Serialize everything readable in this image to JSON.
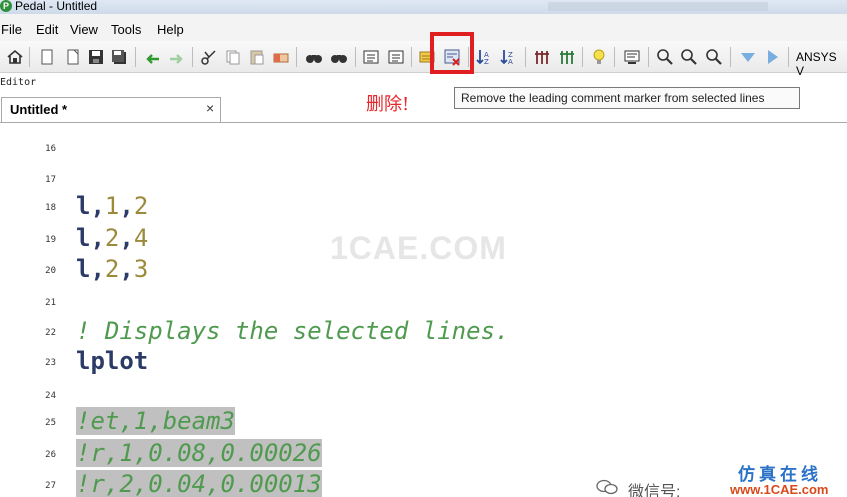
{
  "window": {
    "title": "Pedal - Untitled",
    "app_icon_letter": "P"
  },
  "menu": [
    "File",
    "Edit",
    "View",
    "Tools",
    "Help"
  ],
  "toolbar": {
    "icons": [
      "home-icon",
      "new-file-icon",
      "new-file-icon-2",
      "save-icon",
      "save-all-icon",
      "undo-icon",
      "redo-icon",
      "cut-icon",
      "copy-icon",
      "paste-icon",
      "clear-icon",
      "find-icon",
      "find-next-icon",
      "indent-icon",
      "outdent-icon",
      "comment-icon",
      "uncomment-icon",
      "sort-ascending-icon",
      "sort-descending-icon",
      "column-icon",
      "column-icon-2",
      "hint-bulb-icon",
      "settings-panel-icon",
      "zoom-in-icon",
      "zoom-out-icon",
      "zoom-reset-icon",
      "arrow-down-icon",
      "arrow-right-icon"
    ],
    "ansys_label": "ANSYS V",
    "highlight_color": "#e02020"
  },
  "editor_label": "Editor",
  "annotation_delete": "删除!",
  "tooltip": "Remove the leading comment marker from selected lines",
  "tab": {
    "label": "Untitled *",
    "close": "×"
  },
  "code_lines": [
    {
      "n": "16",
      "tokens": []
    },
    {
      "n": "17",
      "tokens": []
    },
    {
      "n": "18",
      "tokens": [
        {
          "t": "l",
          "c": "kw"
        },
        {
          "t": ",",
          "c": "kw"
        },
        {
          "t": "1",
          "c": "num"
        },
        {
          "t": ",",
          "c": "kw"
        },
        {
          "t": "2",
          "c": "num"
        }
      ]
    },
    {
      "n": "19",
      "tokens": [
        {
          "t": "l",
          "c": "kw"
        },
        {
          "t": ",",
          "c": "kw"
        },
        {
          "t": "2",
          "c": "num"
        },
        {
          "t": ",",
          "c": "kw"
        },
        {
          "t": "4",
          "c": "num"
        }
      ]
    },
    {
      "n": "20",
      "tokens": [
        {
          "t": "l",
          "c": "kw"
        },
        {
          "t": ",",
          "c": "kw"
        },
        {
          "t": "2",
          "c": "num"
        },
        {
          "t": ",",
          "c": "kw"
        },
        {
          "t": "3",
          "c": "num"
        }
      ]
    },
    {
      "n": "21",
      "tokens": []
    },
    {
      "n": "22",
      "tokens": [
        {
          "t": "! Displays the selected lines.",
          "c": "cmt"
        }
      ]
    },
    {
      "n": "23",
      "tokens": [
        {
          "t": "lplot",
          "c": "kw"
        }
      ]
    },
    {
      "n": "24",
      "tokens": []
    },
    {
      "n": "25",
      "tokens": [
        {
          "t": "!et,1,beam3",
          "c": "cmt sel"
        }
      ]
    },
    {
      "n": "26",
      "tokens": [
        {
          "t": "!r,1,0.08,0.00026",
          "c": "cmt sel"
        }
      ]
    },
    {
      "n": "27",
      "tokens": [
        {
          "t": "!r,2,0.04,0.00013",
          "c": "cmt sel"
        }
      ]
    }
  ],
  "watermarks": {
    "center": "1CAE.COM",
    "wechat": "微信号: ",
    "logo_top": "仿真在线",
    "logo_bottom": "www.1CAE.com"
  }
}
